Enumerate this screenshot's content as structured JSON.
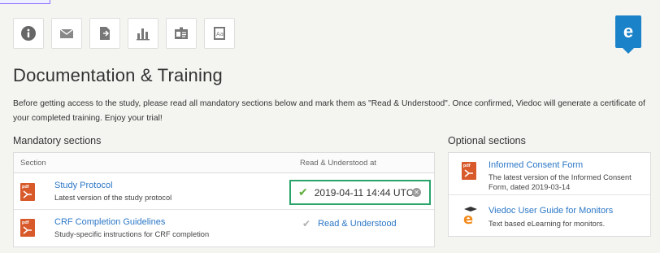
{
  "toolbar": {
    "icons": [
      "info-icon",
      "mail-icon",
      "document-export-icon",
      "chart-icon",
      "id-card-icon",
      "text-document-icon"
    ]
  },
  "logo": {
    "glyph": "e"
  },
  "page": {
    "title": "Documentation & Training",
    "intro": "Before getting access to the study, please read all mandatory sections below and mark them as \"Read & Understood\". Once confirmed, Viedoc will generate a certificate of your completed training. Enjoy your trial!"
  },
  "mandatory": {
    "heading": "Mandatory sections",
    "col_section": "Section",
    "col_read": "Read & Understood at",
    "rows": [
      {
        "title": "Study Protocol",
        "subtitle": "Latest version of the study protocol",
        "read_at": "2019-04-11 14:44 UTC"
      },
      {
        "title": "CRF Completion Guidelines",
        "subtitle": "Study-specific instructions for CRF completion",
        "read_label": "Read & Understood"
      }
    ]
  },
  "optional": {
    "heading": "Optional sections",
    "items": [
      {
        "title": "Informed Consent Form",
        "description": "The latest version of the Informed Consent Form, dated 2019-03-14"
      },
      {
        "title": "Viedoc User Guide for Monitors",
        "description": "Text based eLearning for monitors."
      }
    ]
  },
  "pdf_label": "pdf",
  "colors": {
    "accent": "#1a82c8",
    "link": "#2b77c6",
    "pdf": "#d85a2a",
    "success": "#2aa46b"
  }
}
